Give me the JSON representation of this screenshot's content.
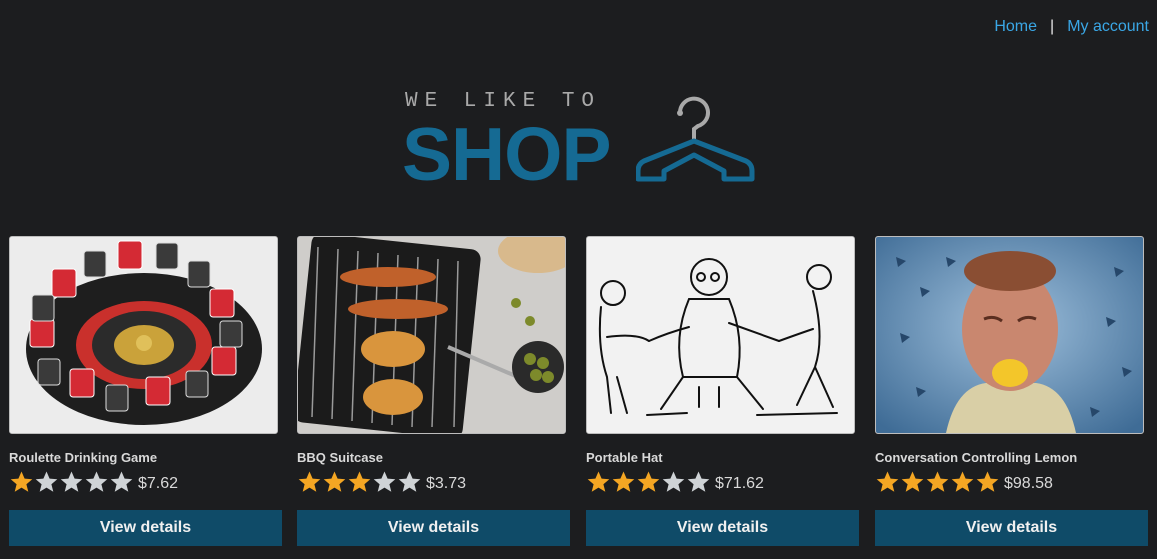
{
  "nav": {
    "home": "Home",
    "separator": "|",
    "account": "My account"
  },
  "logo": {
    "tagline": "WE LIKE TO",
    "word": "SHOP"
  },
  "colors": {
    "accent": "#156a93",
    "button": "#0f4b68",
    "link": "#3aa7e6",
    "star": "#f4a623",
    "star_empty": "#cfd3d6"
  },
  "products": [
    {
      "name": "Roulette Drinking Game",
      "rating": 1,
      "price": "$7.62",
      "button": "View details",
      "image": "roulette-drinking-game-photo"
    },
    {
      "name": "BBQ Suitcase",
      "rating": 3,
      "price": "$3.73",
      "button": "View details",
      "image": "bbq-grill-photo"
    },
    {
      "name": "Portable Hat",
      "rating": 3,
      "price": "$71.62",
      "button": "View details",
      "image": "sketch-illustration"
    },
    {
      "name": "Conversation Controlling Lemon",
      "rating": 5,
      "price": "$98.58",
      "button": "View details",
      "image": "man-with-lemon-photo"
    }
  ]
}
